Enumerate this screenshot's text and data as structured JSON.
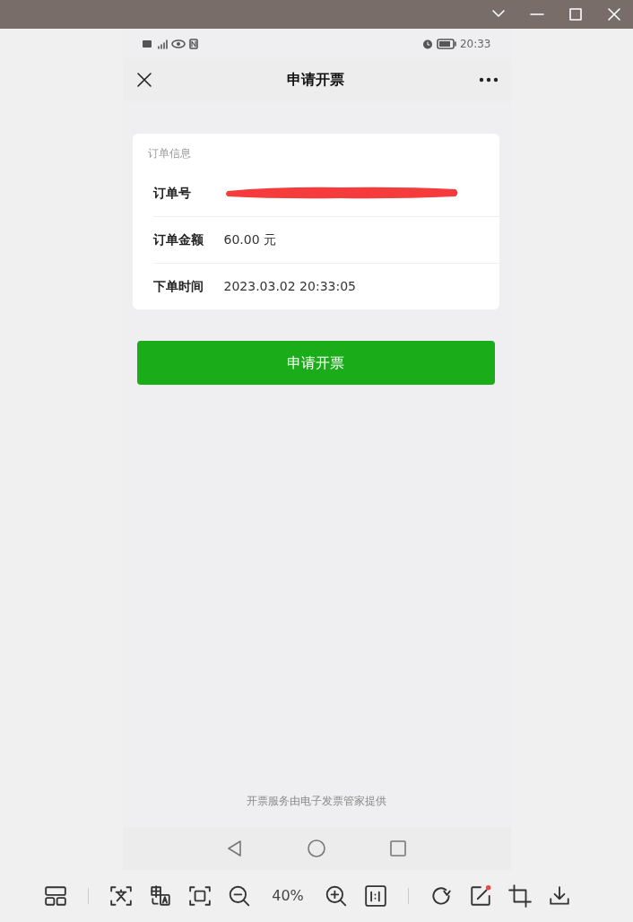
{
  "phone": {
    "status_bar": {
      "time": "20:33"
    },
    "nav_bar": {
      "title": "申请开票"
    },
    "order_card": {
      "title": "订单信息",
      "rows": [
        {
          "kind": "redacted",
          "label": "订单号"
        },
        {
          "kind": "text",
          "label": "订单金额",
          "value": "60.00 元"
        },
        {
          "kind": "text",
          "label": "下单时间",
          "value": "2023.03.02 20:33:05"
        }
      ]
    },
    "primary_button": "申请开票",
    "footer": "开票服务由电子发票管家提供"
  },
  "viewer_toolbar": {
    "zoom": "40%"
  }
}
